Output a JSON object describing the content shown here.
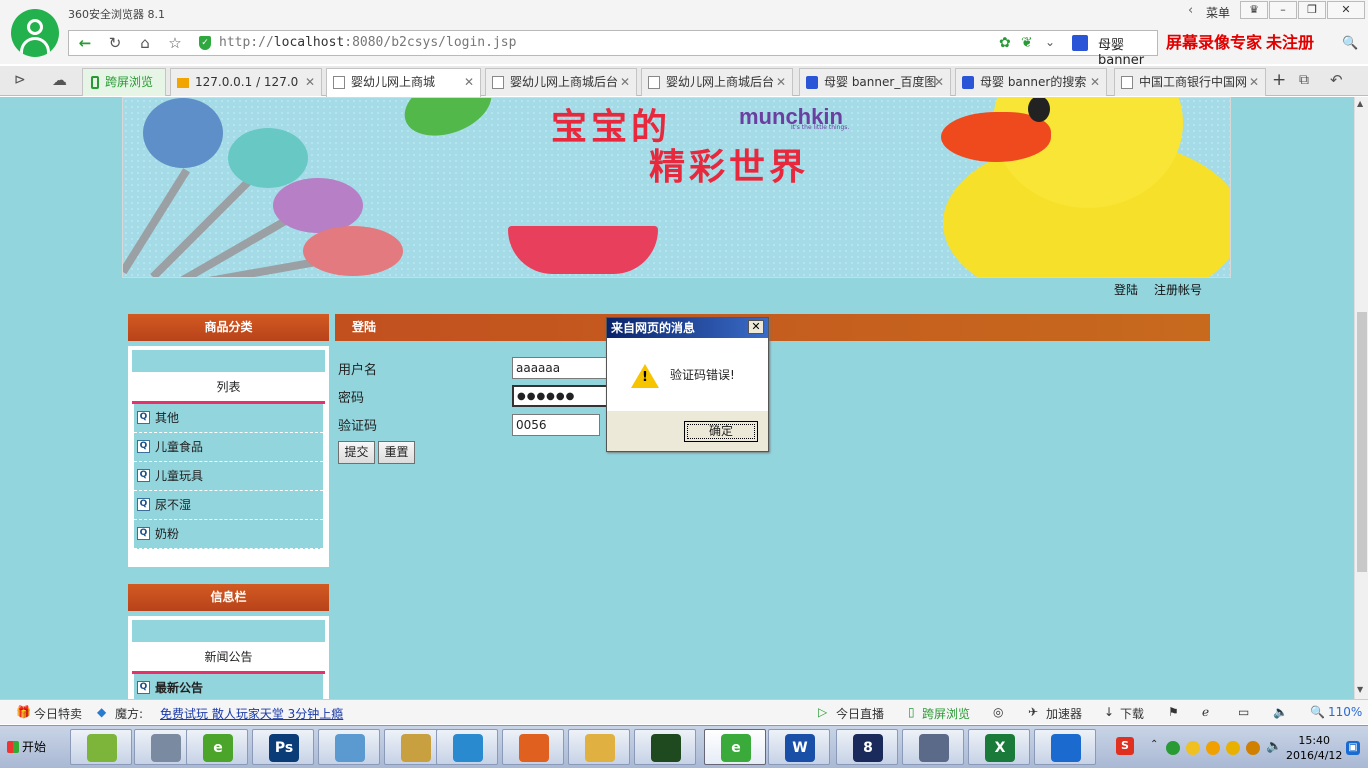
{
  "browser": {
    "app_title": "360安全浏览器 8.1",
    "menu_label": "菜单",
    "recorder_watermark": "屏幕录像专家  未注册",
    "url_prefix": "http://",
    "url_host": "localhost",
    "url_rest": ":8080/b2csys/login.jsp",
    "search_text": "母婴  banner",
    "kuaping_tab": "跨屏浏览",
    "tabs": [
      {
        "label": "127.0.0.1 / 127.0",
        "icon": "pma-icon"
      },
      {
        "label": "婴幼儿网上商城",
        "icon": "page-icon"
      },
      {
        "label": "婴幼儿网上商城后台",
        "icon": "page-icon"
      },
      {
        "label": "婴幼儿网上商城后台",
        "icon": "page-icon"
      },
      {
        "label": "母婴  banner_百度图",
        "icon": "baidu-paw-icon"
      },
      {
        "label": "母婴  banner的搜索",
        "icon": "baidu-paw-icon"
      },
      {
        "label": "中国工商银行中国网",
        "icon": "page-icon"
      }
    ],
    "active_tab": 1
  },
  "banner": {
    "slogan_line1": "宝宝的",
    "slogan_line2": "精彩世界",
    "brand": "munchkin",
    "brand_tagline": "It's the little things."
  },
  "top_links": [
    "登陆",
    "注册帐号"
  ],
  "sidebar": {
    "category_header": "商品分类",
    "category_sub": "列表",
    "categories": [
      "其他",
      "儿童食品",
      "儿童玩具",
      "尿不湿",
      "奶粉"
    ],
    "info_header": "信息栏",
    "info_sub": "新闻公告",
    "info_first_item": "最新公告"
  },
  "login": {
    "header": "登陆",
    "username_label": "用户名",
    "username_value": "aaaaaa",
    "password_label": "密码",
    "password_value": "●●●●●●",
    "captcha_label": "验证码",
    "captcha_value": "0056",
    "submit_label": "提交",
    "reset_label": "重置"
  },
  "dialog": {
    "title": "来自网页的消息",
    "message": "验证码错误!",
    "ok_label": "确定",
    "close_glyph": "✕"
  },
  "statusbar": {
    "deals": "今日特卖",
    "mofang": "魔方:",
    "ad_link": "免费试玩 散人玩家天堂 3分钟上瘾",
    "live": "今日直播",
    "kuaping": "跨屏浏览",
    "accelerator": "加速器",
    "download": "下载",
    "zoom": "110%"
  },
  "taskbar": {
    "start_label": "开始",
    "clock_time": "15:40",
    "clock_date": "2016/4/12",
    "apps": [
      {
        "name": "android-icon",
        "glyph": "",
        "color": "#7cb53a"
      },
      {
        "name": "network-tool-icon",
        "glyph": "",
        "color": "#7a8aa0"
      },
      {
        "name": "dreamweaver-icon",
        "glyph": "e",
        "color": "#4aa52a"
      },
      {
        "name": "photoshop-icon",
        "glyph": "Ps",
        "color": "#0a3c78"
      },
      {
        "name": "transfer-icon",
        "glyph": "",
        "color": "#5a9ad0"
      },
      {
        "name": "db-tools-icon",
        "glyph": "",
        "color": "#c8a040"
      },
      {
        "name": "globe-icon",
        "glyph": "",
        "color": "#2a8ad0"
      },
      {
        "name": "stack-icon",
        "glyph": "",
        "color": "#e06020"
      },
      {
        "name": "folder-icon",
        "glyph": "",
        "color": "#e0b040"
      },
      {
        "name": "image-viewer-icon",
        "glyph": "",
        "color": "#1f4a20"
      },
      {
        "name": "browser-360-icon",
        "glyph": "e",
        "color": "#3aaa3a"
      },
      {
        "name": "word-icon",
        "glyph": "W",
        "color": "#1a4fa8"
      },
      {
        "name": "eclipse-icon",
        "glyph": "8",
        "color": "#1a2a5a"
      },
      {
        "name": "remote-desktop-icon",
        "glyph": "",
        "color": "#5a6a88"
      },
      {
        "name": "excel-icon",
        "glyph": "X",
        "color": "#1a7a3a"
      },
      {
        "name": "teamviewer-icon",
        "glyph": "",
        "color": "#1a6ad0"
      }
    ]
  }
}
